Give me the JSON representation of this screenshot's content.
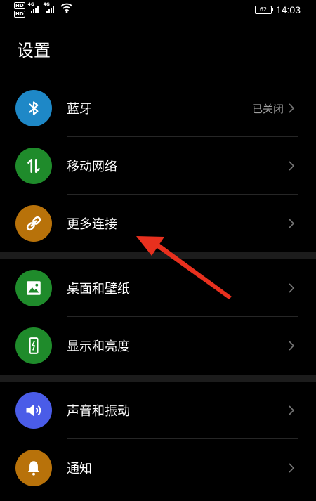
{
  "status_bar": {
    "hd_badge_1": "HD",
    "hd_badge_2": "HD",
    "signal_1_label": "4G",
    "signal_2_label": "4G",
    "battery_level": "62",
    "time": "14:03"
  },
  "page": {
    "title": "设置"
  },
  "settings": {
    "bluetooth": {
      "label": "蓝牙",
      "value": "已关闭",
      "icon": "bluetooth-icon",
      "color": "#1e88c7"
    },
    "mobile_network": {
      "label": "移动网络",
      "icon": "data-transfer-icon",
      "color": "#1f8b2b"
    },
    "more_connections": {
      "label": "更多连接",
      "icon": "link-icon",
      "color": "#b8720a"
    },
    "wallpaper": {
      "label": "桌面和壁纸",
      "icon": "image-icon",
      "color": "#1f8b2b"
    },
    "display": {
      "label": "显示和亮度",
      "icon": "phone-brightness-icon",
      "color": "#1f8b2b"
    },
    "sound": {
      "label": "声音和振动",
      "icon": "speaker-icon",
      "color": "#4a5ce8"
    },
    "notifications": {
      "label": "通知",
      "icon": "bell-icon",
      "color": "#b8720a"
    }
  },
  "annotation": {
    "color": "#e8301e",
    "points_to": "more_connections"
  }
}
